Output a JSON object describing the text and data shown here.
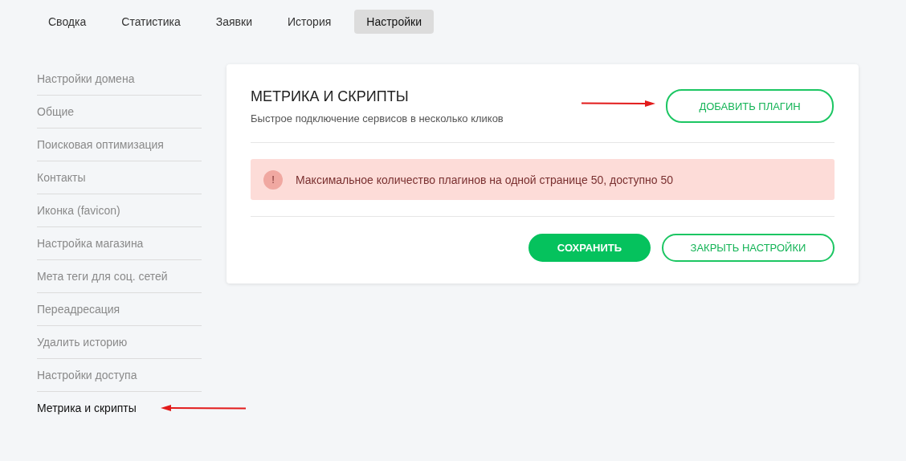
{
  "tabs": [
    {
      "label": "Сводка",
      "selected": false
    },
    {
      "label": "Статистика",
      "selected": false
    },
    {
      "label": "Заявки",
      "selected": false
    },
    {
      "label": "История",
      "selected": false
    },
    {
      "label": "Настройки",
      "selected": true
    }
  ],
  "sidebar": {
    "items": [
      {
        "label": "Настройки домена",
        "selected": false
      },
      {
        "label": "Общие",
        "selected": false
      },
      {
        "label": "Поисковая оптимизация",
        "selected": false
      },
      {
        "label": "Контакты",
        "selected": false
      },
      {
        "label": "Иконка (favicon)",
        "selected": false
      },
      {
        "label": "Настройка магазина",
        "selected": false
      },
      {
        "label": "Мета теги для соц. сетей",
        "selected": false
      },
      {
        "label": "Переадресация",
        "selected": false
      },
      {
        "label": "Удалить историю",
        "selected": false
      },
      {
        "label": "Настройки доступа",
        "selected": false
      },
      {
        "label": "Метрика и скрипты",
        "selected": true
      }
    ]
  },
  "panel": {
    "title": "МЕТРИКА И СКРИПТЫ",
    "subtitle": "Быстрое подключение сервисов в несколько кликов",
    "add_button": "ДОБАВИТЬ ПЛАГИН",
    "alert": {
      "icon": "!",
      "text": "Максимальное количество плагинов на одной странице 50, доступно 50"
    },
    "buttons": [
      {
        "label": "СОХРАНИТЬ",
        "kind": "primary"
      },
      {
        "label": "ЗАКРЫТЬ НАСТРОЙКИ",
        "kind": "outline"
      }
    ]
  }
}
